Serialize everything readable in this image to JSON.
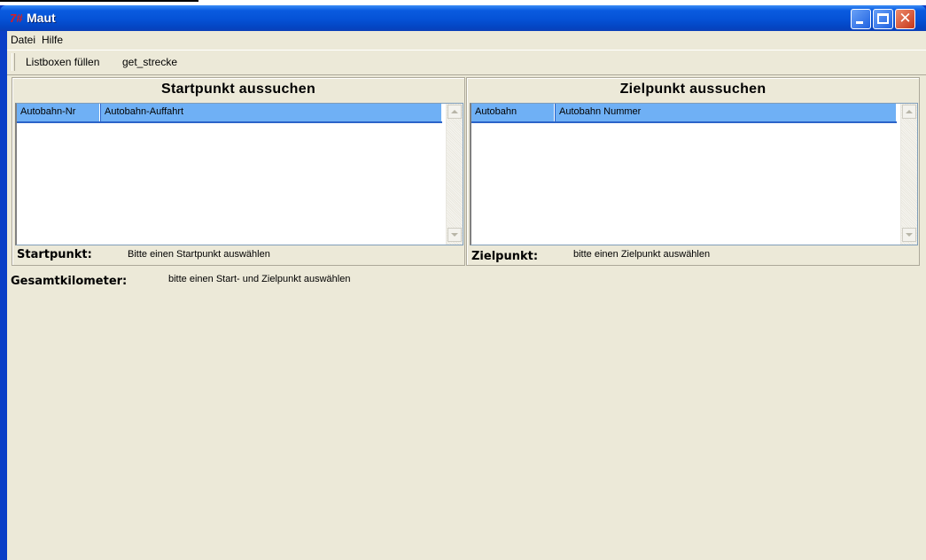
{
  "window": {
    "title": "Maut",
    "icon": "app-icon-7#"
  },
  "menu": {
    "items": [
      "Datei",
      "Hilfe"
    ]
  },
  "toolbar": {
    "buttons": [
      "Listboxen füllen",
      "get_strecke"
    ]
  },
  "start": {
    "title": "Startpunkt aussuchen",
    "columns": [
      "Autobahn-Nr",
      "Autobahn-Auffahrt"
    ],
    "label": "Startpunkt:",
    "value": "Bitte einen Startpunkt auswählen"
  },
  "ziel": {
    "title": "Zielpunkt aussuchen",
    "columns": [
      "Autobahn",
      "Autobahn Nummer"
    ],
    "label": "Zielpunkt:",
    "value": "bitte einen Zielpunkt auswählen"
  },
  "gesamt": {
    "label": "Gesamtkilometer:",
    "value": "bitte einen Start- und Zielpunkt auswählen"
  },
  "colors": {
    "titlebar": "#0552d6",
    "header": "#6fb0f5",
    "client": "#ece9d8"
  }
}
